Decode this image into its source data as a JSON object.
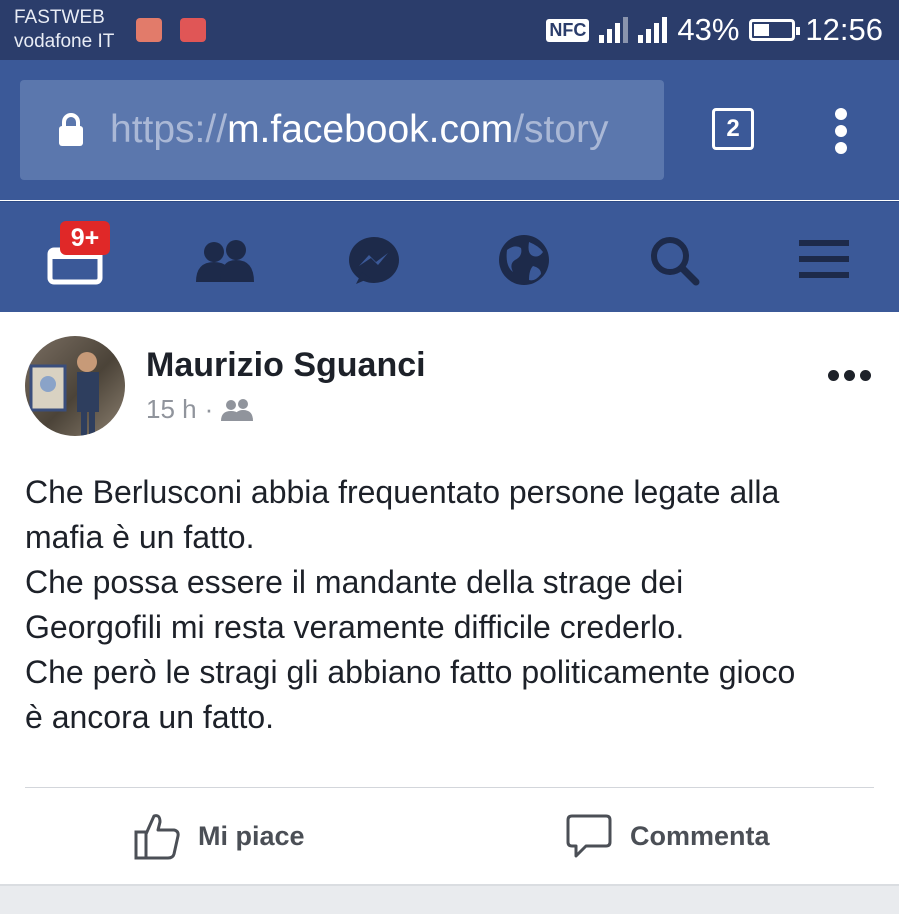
{
  "status_bar": {
    "carrier_1": "FASTWEB",
    "carrier_2": "vodafone IT",
    "nfc": "NFC",
    "battery_percent": "43%",
    "battery_level": 0.43,
    "time": "12:56"
  },
  "browser": {
    "url_scheme": "https://",
    "url_domain": "m.facebook.com",
    "url_path": "/story",
    "tab_count": "2"
  },
  "nav": {
    "notifications_badge": "9+",
    "icons": [
      "notifications-icon",
      "friends-icon",
      "messenger-icon",
      "globe-icon",
      "search-icon",
      "menu-icon"
    ]
  },
  "post": {
    "author": "Maurizio Sguanci",
    "time": "15 h",
    "separator": "·",
    "audience_icon": "friends-icon",
    "lines": [
      "Che Berlusconi abbia frequentato persone legate alla",
      "mafia è un fatto.",
      "Che possa essere il mandante della strage dei",
      "Georgofili mi resta veramente difficile crederlo.",
      "Che però le stragi gli abbiano fatto politicamente gioco",
      "è ancora un fatto."
    ],
    "like_label": "Mi piace",
    "comment_label": "Commenta"
  },
  "colors": {
    "status_bar": "#2b3d6b",
    "facebook_blue": "#3b5998",
    "url_box": "#5b77ad",
    "text": "#1d2129",
    "muted": "#90949c",
    "action_text": "#4b4f56"
  }
}
